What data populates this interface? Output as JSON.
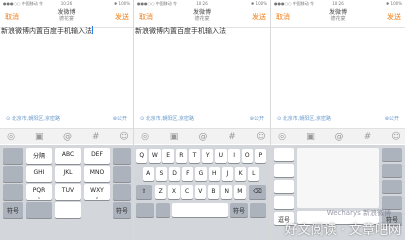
{
  "status": {
    "left": "●●●○○ 中国移动 令",
    "center": "10:26",
    "right": "✱ 100%"
  },
  "nav": {
    "cancel": "取消",
    "title": "发微博",
    "subtitle": "德花宴",
    "send": "发送"
  },
  "compose_text": "新浪微博内置百度手机输入法",
  "location": "北京市,朝阳区,京密路",
  "visibility": "公开",
  "toolbar_icons": [
    "camera-icon",
    "image-icon",
    "at-icon",
    "hashtag-icon",
    "emoji-icon"
  ],
  "toolbar_glyphs": [
    "◎",
    "▣",
    "@",
    "#",
    "☺"
  ],
  "k9": {
    "rows": [
      [
        {
          "main": "分隔",
          "sub": ""
        },
        {
          "main": "ABC",
          "sub": ""
        },
        {
          "main": "DEF",
          "sub": ""
        }
      ],
      [
        {
          "main": "GHI",
          "sub": ""
        },
        {
          "main": "JKL",
          "sub": ""
        },
        {
          "main": "MNO",
          "sub": ""
        }
      ],
      [
        {
          "main": "PQR",
          "sub": "S"
        },
        {
          "main": "TUV",
          "sub": ""
        },
        {
          "main": "WXY",
          "sub": "Z"
        }
      ]
    ],
    "bottom_left": "符号",
    "space": "",
    "right_labels": [
      "",
      "",
      "",
      "",
      "符号"
    ]
  },
  "qwerty": {
    "row1": [
      "Q",
      "W",
      "E",
      "R",
      "T",
      "Y",
      "U",
      "I",
      "O",
      "P"
    ],
    "row2": [
      "A",
      "S",
      "D",
      "F",
      "G",
      "H",
      "J",
      "K",
      "L"
    ],
    "row3": [
      "Z",
      "X",
      "C",
      "V",
      "B",
      "N",
      "M"
    ],
    "shift": "⇧",
    "delete": "⌫",
    "symbol_key": "符号"
  },
  "hw": {
    "left_labels": [
      "",
      "",
      "",
      "",
      "逗号"
    ],
    "right_labels": [
      "",
      "",
      "",
      "",
      "符号"
    ]
  },
  "watermark": "好文阅读 · 文章吧网",
  "watermark_small": "Wecharys 新浪微博"
}
